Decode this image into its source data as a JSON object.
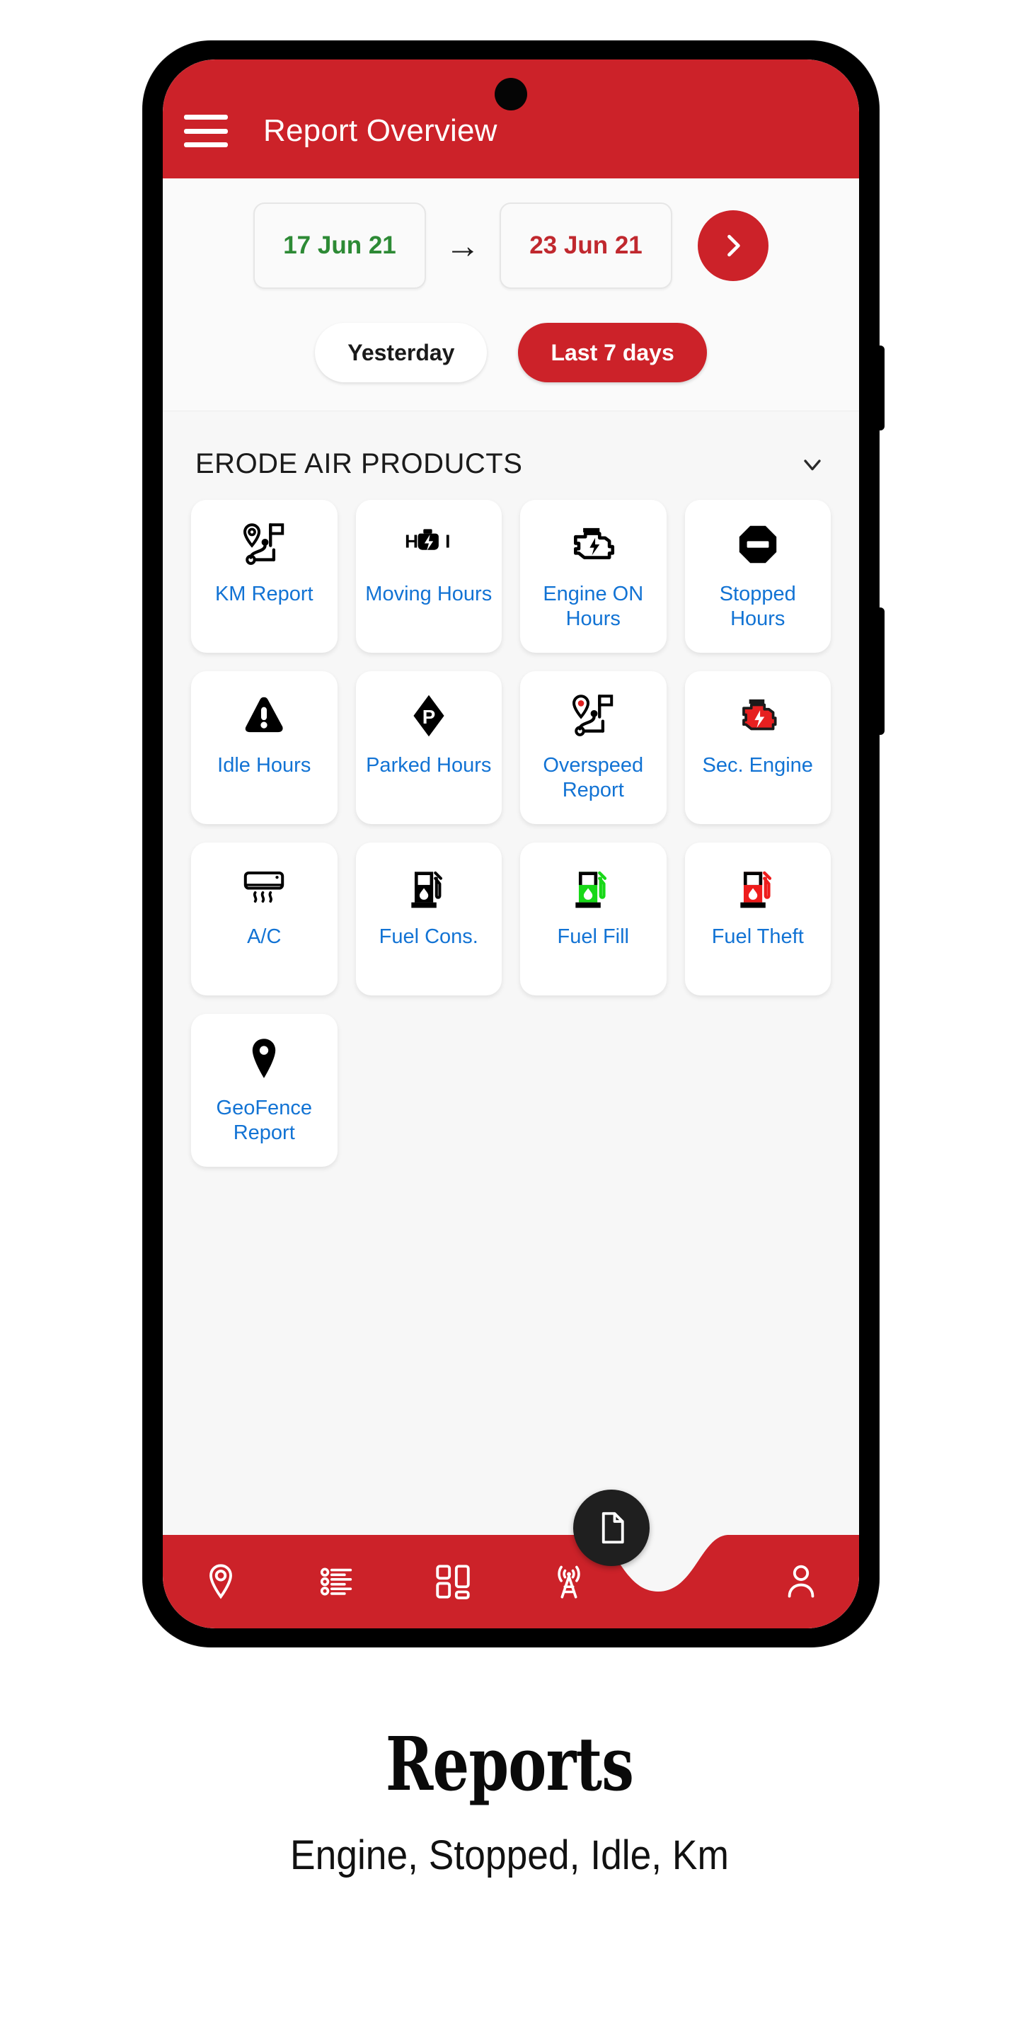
{
  "appbar": {
    "menu_icon": "hamburger-menu-icon",
    "title": "Report Overview"
  },
  "filter": {
    "date_from": "17 Jun 21",
    "date_to": "23 Jun 21",
    "arrow": "→",
    "go_icon": "chevron-right-icon",
    "quick_options": [
      {
        "label": "Yesterday",
        "active": false
      },
      {
        "label": "Last 7 days",
        "active": true
      }
    ]
  },
  "group": {
    "name": "ERODE AIR PRODUCTS",
    "expand_icon": "chevron-down-icon"
  },
  "reports": [
    {
      "label": "KM Report",
      "icon": "route-pin-flag-icon"
    },
    {
      "label": "Moving Hours",
      "icon": "engine-bolt-h-icon"
    },
    {
      "label": "Engine ON Hours",
      "icon": "engine-bolt-icon"
    },
    {
      "label": "Stopped Hours",
      "icon": "stop-sign-icon"
    },
    {
      "label": "Idle Hours",
      "icon": "warning-triangle-icon"
    },
    {
      "label": "Parked Hours",
      "icon": "parking-diamond-icon"
    },
    {
      "label": "Overspeed Report",
      "icon": "route-pin-flag-red-icon"
    },
    {
      "label": "Sec. Engine",
      "icon": "engine-red-icon"
    },
    {
      "label": "A/C",
      "icon": "air-conditioner-icon"
    },
    {
      "label": "Fuel Cons.",
      "icon": "fuel-pump-black-icon"
    },
    {
      "label": "Fuel Fill",
      "icon": "fuel-pump-green-icon"
    },
    {
      "label": "Fuel Theft",
      "icon": "fuel-pump-red-icon"
    },
    {
      "label": "GeoFence Report",
      "icon": "map-pin-icon"
    }
  ],
  "bottom_nav": [
    {
      "icon": "location-pin-icon"
    },
    {
      "icon": "list-icon"
    },
    {
      "icon": "dashboard-grid-icon"
    },
    {
      "icon": "broadcast-tower-icon"
    },
    {
      "icon": "profile-person-icon"
    }
  ],
  "fab": {
    "icon": "document-icon"
  },
  "caption": {
    "title": "Reports",
    "subtitle": "Engine, Stopped, Idle, Km"
  },
  "colors": {
    "brand_red": "#cc2229",
    "link_blue": "#1273d4",
    "date_from_green": "#2d8a35",
    "date_to_red": "#c0282e",
    "fab_dark": "#1f1f1f"
  }
}
